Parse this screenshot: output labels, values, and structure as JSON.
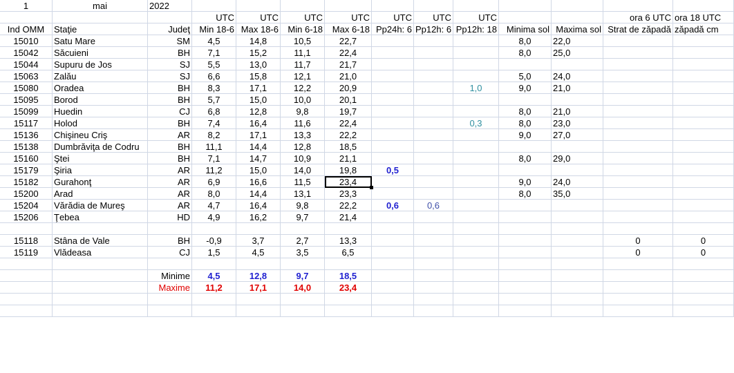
{
  "header_row": {
    "day": "1",
    "month": "mai",
    "year": "2022"
  },
  "utc_row": [
    "UTC",
    "UTC",
    "UTC",
    "UTC",
    "UTC",
    "UTC",
    "UTC"
  ],
  "utc_extra": {
    "ora6": "ora 6 UTC",
    "ora18": "ora 18 UTC"
  },
  "columns": [
    "Ind OMM",
    "Staţie",
    "Judeţ",
    "Min 18-6",
    "Max 18-6",
    "Min 6-18",
    "Max 6-18",
    "Pp24h: 6",
    "Pp12h: 6",
    "Pp12h: 18",
    "Minima sol",
    "Maxima sol",
    "Strat de zăpadă",
    "zăpadă cm"
  ],
  "rows": [
    {
      "id": "15010",
      "station": "Satu Mare",
      "county": "SM",
      "min186": "4,5",
      "max186": "14,8",
      "min618": "10,5",
      "max618": "22,7",
      "pp24": "",
      "pp12a": "",
      "pp12b": "",
      "minsol": "8,0",
      "maxsol": "22,0",
      "snow6": "",
      "snow18": ""
    },
    {
      "id": "15042",
      "station": "Săcuieni",
      "county": "BH",
      "min186": "7,1",
      "max186": "15,2",
      "min618": "11,1",
      "max618": "22,4",
      "pp24": "",
      "pp12a": "",
      "pp12b": "",
      "minsol": "8,0",
      "maxsol": "25,0",
      "snow6": "",
      "snow18": ""
    },
    {
      "id": "15044",
      "station": "Supuru de Jos",
      "county": "SJ",
      "min186": "5,5",
      "max186": "13,0",
      "min618": "11,7",
      "max618": "21,7",
      "pp24": "",
      "pp12a": "",
      "pp12b": "",
      "minsol": "",
      "maxsol": "",
      "snow6": "",
      "snow18": ""
    },
    {
      "id": "15063",
      "station": "Zalău",
      "county": "SJ",
      "min186": "6,6",
      "max186": "15,8",
      "min618": "12,1",
      "max618": "21,0",
      "pp24": "",
      "pp12a": "",
      "pp12b": "",
      "minsol": "5,0",
      "maxsol": "24,0",
      "snow6": "",
      "snow18": ""
    },
    {
      "id": "15080",
      "station": "Oradea",
      "county": "BH",
      "min186": "8,3",
      "max186": "17,1",
      "min618": "12,2",
      "max618": "20,9",
      "pp24": "",
      "pp12a": "",
      "pp12b": "1,0",
      "minsol": "9,0",
      "maxsol": "21,0",
      "snow6": "",
      "snow18": ""
    },
    {
      "id": "15095",
      "station": "Borod",
      "county": "BH",
      "min186": "5,7",
      "max186": "15,0",
      "min618": "10,0",
      "max618": "20,1",
      "pp24": "",
      "pp12a": "",
      "pp12b": "",
      "minsol": "",
      "maxsol": "",
      "snow6": "",
      "snow18": ""
    },
    {
      "id": "15099",
      "station": "Huedin",
      "county": "CJ",
      "min186": "6,8",
      "max186": "12,8",
      "min618": "9,8",
      "max618": "19,7",
      "pp24": "",
      "pp12a": "",
      "pp12b": "",
      "minsol": "8,0",
      "maxsol": "21,0",
      "snow6": "",
      "snow18": ""
    },
    {
      "id": "15117",
      "station": "Holod",
      "county": "BH",
      "min186": "7,4",
      "max186": "16,4",
      "min618": "11,6",
      "max618": "22,4",
      "pp24": "",
      "pp12a": "",
      "pp12b": "0,3",
      "minsol": "8,0",
      "maxsol": "23,0",
      "snow6": "",
      "snow18": ""
    },
    {
      "id": "15136",
      "station": "Chişineu     Criş",
      "county": "AR",
      "min186": "8,2",
      "max186": "17,1",
      "min618": "13,3",
      "max618": "22,2",
      "pp24": "",
      "pp12a": "",
      "pp12b": "",
      "minsol": "9,0",
      "maxsol": "27,0",
      "snow6": "",
      "snow18": ""
    },
    {
      "id": "15138",
      "station": "Dumbrăviţa   de Codru",
      "county": "BH",
      "min186": "11,1",
      "max186": "14,4",
      "min618": "12,8",
      "max618": "18,5",
      "pp24": "",
      "pp12a": "",
      "pp12b": "",
      "minsol": "",
      "maxsol": "",
      "snow6": "",
      "snow18": ""
    },
    {
      "id": "15160",
      "station": "Ştei",
      "county": "BH",
      "min186": "7,1",
      "max186": "14,7",
      "min618": "10,9",
      "max618": "21,1",
      "pp24": "",
      "pp12a": "",
      "pp12b": "",
      "minsol": "8,0",
      "maxsol": "29,0",
      "snow6": "",
      "snow18": ""
    },
    {
      "id": "15179",
      "station": "Şiria",
      "county": "AR",
      "min186": "11,2",
      "max186": "15,0",
      "min618": "14,0",
      "max618": "19,8",
      "pp24": "0,5",
      "pp12a": "",
      "pp12b": "",
      "minsol": "",
      "maxsol": "",
      "snow6": "",
      "snow18": ""
    },
    {
      "id": "15182",
      "station": "Gurahonţ",
      "county": "AR",
      "min186": "6,9",
      "max186": "16,6",
      "min618": "11,5",
      "max618": "23,4",
      "pp24": "",
      "pp12a": "",
      "pp12b": "",
      "minsol": "9,0",
      "maxsol": "24,0",
      "snow6": "",
      "snow18": ""
    },
    {
      "id": "15200",
      "station": "Arad",
      "county": "AR",
      "min186": "8,0",
      "max186": "14,4",
      "min618": "13,1",
      "max618": "23,3",
      "pp24": "",
      "pp12a": "",
      "pp12b": "",
      "minsol": "8,0",
      "maxsol": "35,0",
      "snow6": "",
      "snow18": ""
    },
    {
      "id": "15204",
      "station": "Vărădia de Mureş",
      "county": "AR",
      "min186": "4,7",
      "max186": "16,4",
      "min618": "9,8",
      "max618": "22,2",
      "pp24": "0,6",
      "pp12a": "0,6",
      "pp12b": "",
      "minsol": "",
      "maxsol": "",
      "snow6": "",
      "snow18": ""
    },
    {
      "id": "15206",
      "station": "Ţebea",
      "county": "HD",
      "min186": "4,9",
      "max186": "16,2",
      "min618": "9,7",
      "max618": "21,4",
      "pp24": "",
      "pp12a": "",
      "pp12b": "",
      "minsol": "",
      "maxsol": "",
      "snow6": "",
      "snow18": ""
    }
  ],
  "mountain_rows": [
    {
      "id": "15118",
      "station": "Stâna de Vale",
      "county": "BH",
      "min186": "-0,9",
      "max186": "3,7",
      "min618": "2,7",
      "max618": "13,3",
      "snow6": "0",
      "snow18": "0"
    },
    {
      "id": "15119",
      "station": "Vlădeasa",
      "county": "CJ",
      "min186": "1,5",
      "max186": "4,5",
      "min618": "3,5",
      "max618": "6,5",
      "snow6": "0",
      "snow18": "0"
    }
  ],
  "summary": {
    "minime": {
      "label": "Minime",
      "v1": "4,5",
      "v2": "12,8",
      "v3": "9,7",
      "v4": "18,5"
    },
    "maxime": {
      "label": "Maxime",
      "v1": "11,2",
      "v2": "17,1",
      "v3": "14,0",
      "v4": "23,4"
    }
  },
  "colors": {
    "grid": "#d0d7e5",
    "blue": "#1f1fd0",
    "red": "#e00000",
    "teal": "#2f8fa0"
  }
}
